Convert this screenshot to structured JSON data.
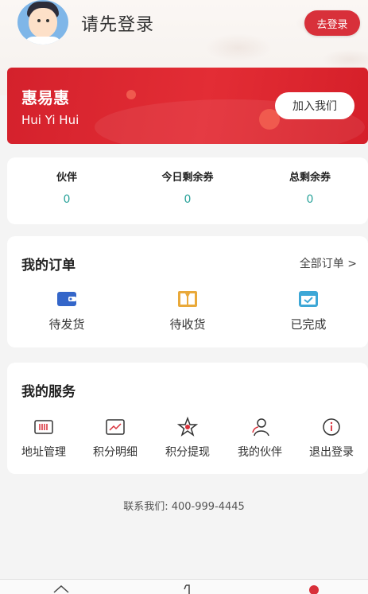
{
  "header": {
    "login_title": "请先登录",
    "login_button": "去登录"
  },
  "banner": {
    "title": "惠易惠",
    "subtitle": "Hui Yi Hui",
    "join_button": "加入我们"
  },
  "stats": [
    {
      "label": "伙伴",
      "value": "0"
    },
    {
      "label": "今日剩余券",
      "value": "0"
    },
    {
      "label": "总剩余券",
      "value": "0"
    }
  ],
  "orders": {
    "title": "我的订单",
    "all_link": "全部订单 >",
    "items": [
      {
        "label": "待发货",
        "icon": "wallet-icon",
        "color": "#3466c9"
      },
      {
        "label": "待收货",
        "icon": "package-icon",
        "color": "#e9a93a"
      },
      {
        "label": "已完成",
        "icon": "completed-icon",
        "color": "#3da7d6"
      }
    ]
  },
  "services": {
    "title": "我的服务",
    "items": [
      {
        "label": "地址管理",
        "icon": "address-icon"
      },
      {
        "label": "积分明细",
        "icon": "chart-icon"
      },
      {
        "label": "积分提现",
        "icon": "star-icon"
      },
      {
        "label": "我的伙伴",
        "icon": "partner-icon"
      },
      {
        "label": "退出登录",
        "icon": "info-icon"
      }
    ]
  },
  "contact": "联系我们:  400-999-4445",
  "colors": {
    "accent": "#d8303a",
    "stat_value": "#2aa39a"
  }
}
